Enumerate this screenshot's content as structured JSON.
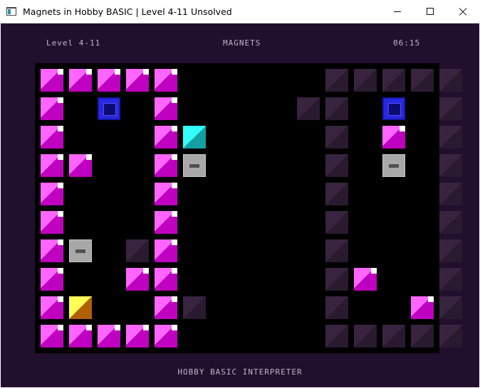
{
  "window": {
    "title": "Magnets in Hobby BASIC  |  Level 4-11  Unsolved",
    "minimize_icon": "minimize-icon",
    "maximize_icon": "maximize-icon",
    "close_icon": "close-icon"
  },
  "hud": {
    "level": "Level 4-11",
    "title": "MAGNETS",
    "timer": "06:15"
  },
  "footer": {
    "text": "HOBBY BASIC INTERPRETER"
  },
  "colors": {
    "background": "#210f2e",
    "board": "#000000",
    "wall_pink": "#ff66ff",
    "wall_dark": "#38243f",
    "magnet_blue": "#2828e0",
    "player_cyan": "#33ffff",
    "target_yellow": "#ffff55",
    "block_grey": "#a8a8a8"
  },
  "board": {
    "cols": 14,
    "rows": 10,
    "legend": {
      "P": "wall-pink",
      "D": "wall-dark",
      "B": "magnet-blue",
      "C": "player-cyan",
      "Y": "target-yellow",
      "G": "block-grey",
      ".": "empty"
    },
    "grid": [
      "PPPPP.....DDDDD",
      "P.B.P....DD.B.D",
      "P...PC....D.P.D",
      "PP..PG....D.G.D",
      "P...P.....D...D",
      "P...P.....D...D",
      "PG.DP.....D...D",
      "P..PP.....DP..D",
      "PY..PD....D..PD",
      "PPPPP.....DDDDD"
    ]
  }
}
